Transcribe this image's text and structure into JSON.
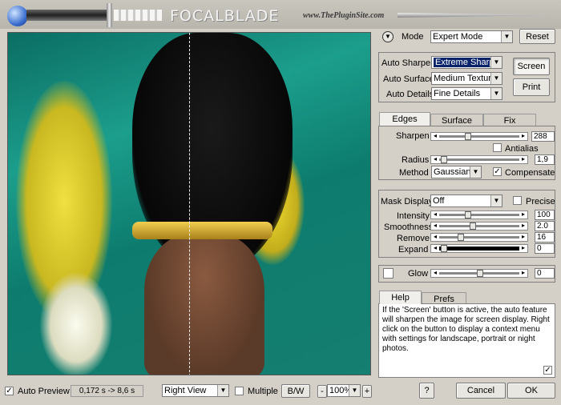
{
  "header": {
    "logo": "FOCALBLADE",
    "site": "www.ThePluginSite.com"
  },
  "mode": {
    "label": "Mode",
    "value": "Expert Mode",
    "reset": "Reset"
  },
  "auto": {
    "sharpen_label": "Auto Sharpen",
    "sharpen_value": "Extreme Sharp",
    "surface_label": "Auto Surface",
    "surface_value": "Medium Texturec",
    "details_label": "Auto Details",
    "details_value": "Fine Details",
    "screen": "Screen",
    "print": "Print"
  },
  "tabs1": [
    "Edges",
    "Surface",
    "Fix"
  ],
  "edges": {
    "sharpen_label": "Sharpen",
    "sharpen_value": "288",
    "antialias": "Antialias",
    "radius_label": "Radius",
    "radius_value": "1,9",
    "method_label": "Method",
    "method_value": "Gaussian",
    "compensate": "Compensate"
  },
  "mask": {
    "display_label": "Mask Display",
    "display_value": "Off",
    "precise": "Precise",
    "intensity_label": "Intensity",
    "intensity_value": "100",
    "smoothness_label": "Smoothness",
    "smoothness_value": "2.0",
    "remove_label": "Remove",
    "remove_value": "16",
    "expand_label": "Expand",
    "expand_value": "0"
  },
  "glow": {
    "label": "Glow",
    "value": "0"
  },
  "tabs2": [
    "Help",
    "Prefs"
  ],
  "help_text": "If the 'Screen' button is active, the auto feature will sharpen the image for screen display. Right click on the button to display a context menu with settings for landscape, portrait or night photos.",
  "footer": {
    "auto_preview": "Auto Preview",
    "timing": "0,172 s -> 8,6 s",
    "view": "Right View",
    "multiple": "Multiple",
    "bw": "B/W",
    "minus": "-",
    "zoom": "100%",
    "plus": "+",
    "help": "?",
    "cancel": "Cancel",
    "ok": "OK"
  },
  "colors": {
    "accent": "#0a246a",
    "bg": "#d4d0c8",
    "green": "#0f8a7a",
    "yellow": "#e8d020"
  }
}
